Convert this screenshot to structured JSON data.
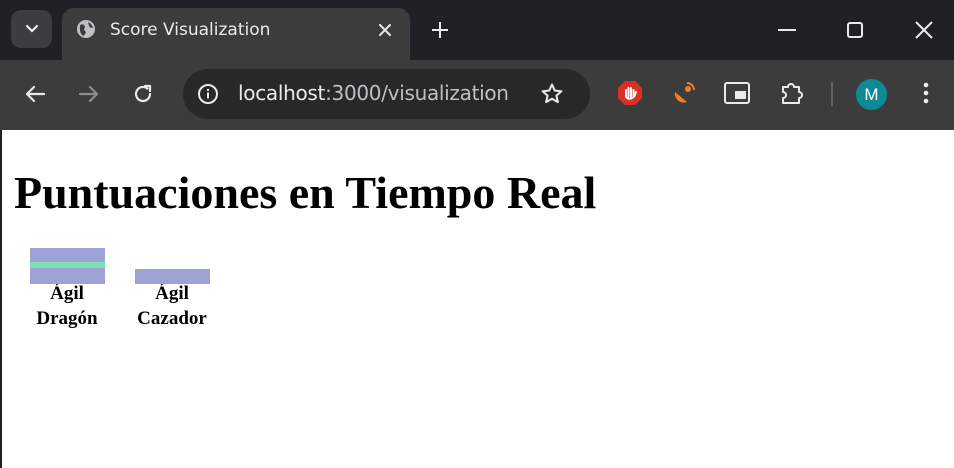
{
  "browser": {
    "tab": {
      "title": "Score Visualization"
    },
    "url": {
      "host": "localhost",
      "path": ":3000/visualization"
    },
    "profile_initial": "M",
    "colors": {
      "accent": "#0e8a96",
      "bar_primary": "#9ea1d6",
      "bar_secondary": "#7fe0b8"
    }
  },
  "page": {
    "title": "Puntuaciones en Tiempo Real",
    "players": [
      {
        "line1": "Ágil",
        "line2": "Dragón",
        "segments": [
          {
            "color": "#9ea1d6",
            "value": 14
          },
          {
            "color": "#7fe0b8",
            "value": 6
          },
          {
            "color": "#9ea1d6",
            "value": 16
          }
        ]
      },
      {
        "line1": "Ágil",
        "line2": "Cazador",
        "segments": [
          {
            "color": "#9ea1d6",
            "value": 15
          }
        ]
      }
    ]
  }
}
